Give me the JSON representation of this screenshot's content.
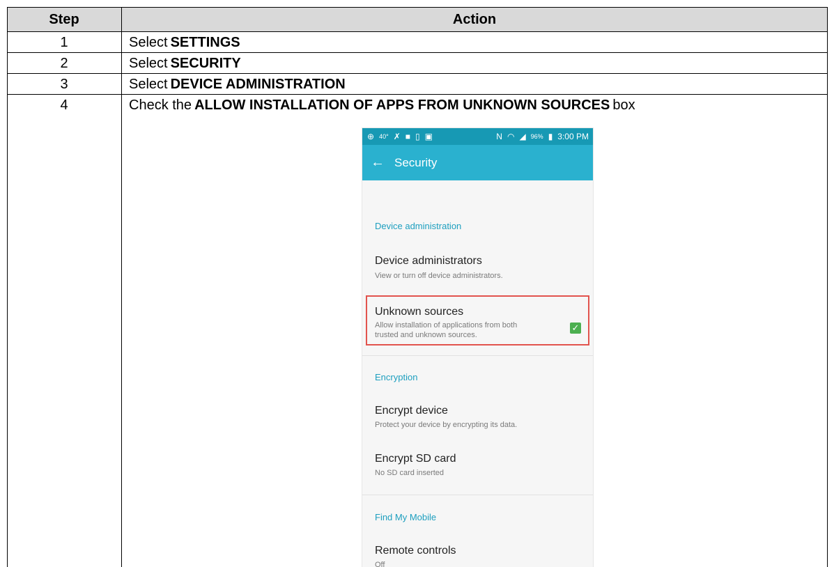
{
  "table": {
    "headers": {
      "step": "Step",
      "action": "Action"
    },
    "rows": [
      {
        "step": "1",
        "prefix": "Select",
        "bold": "SETTINGS",
        "suffix": ""
      },
      {
        "step": "2",
        "prefix": "Select",
        "bold": "SECURITY",
        "suffix": ""
      },
      {
        "step": "3",
        "prefix": "Select",
        "bold": "DEVICE ADMINISTRATION",
        "suffix": ""
      },
      {
        "step": "4",
        "prefix": "Check the",
        "bold": "ALLOW INSTALLATION OF APPS FROM UNKNOWN SOURCES",
        "suffix": "box"
      }
    ]
  },
  "phone": {
    "status_bar": {
      "temperature": "40°",
      "battery_percent": "96%",
      "time": "3:00 PM",
      "icons": [
        "plus-badge-icon",
        "call-missed-icon",
        "lock-icon",
        "vibrate-icon",
        "image-icon",
        "nfc-icon",
        "wifi-icon",
        "signal-icon",
        "battery-icon"
      ]
    },
    "app_bar": {
      "title": "Security",
      "back_icon": "arrow-back-icon"
    },
    "sections": [
      {
        "header": "Device administration",
        "items": [
          {
            "title": "Device administrators",
            "subtitle": "View or turn off device administrators."
          },
          {
            "title": "Unknown sources",
            "subtitle_line1": "Allow installation of applications from both",
            "subtitle_line2": "trusted and unknown sources.",
            "checked": true
          }
        ]
      },
      {
        "header": "Encryption",
        "items": [
          {
            "title": "Encrypt device",
            "subtitle": "Protect your device by encrypting its data."
          },
          {
            "title": "Encrypt SD card",
            "subtitle": "No SD card inserted"
          }
        ]
      },
      {
        "header": "Find My Mobile",
        "items": [
          {
            "title": "Remote controls",
            "subtitle": "Off"
          }
        ]
      }
    ],
    "colors": {
      "status_bar": "#1799b4",
      "app_bar": "#2ab1cf",
      "accent": "#1d9fbf",
      "highlight": "#e2534d",
      "checkbox": "#4caf50"
    }
  }
}
